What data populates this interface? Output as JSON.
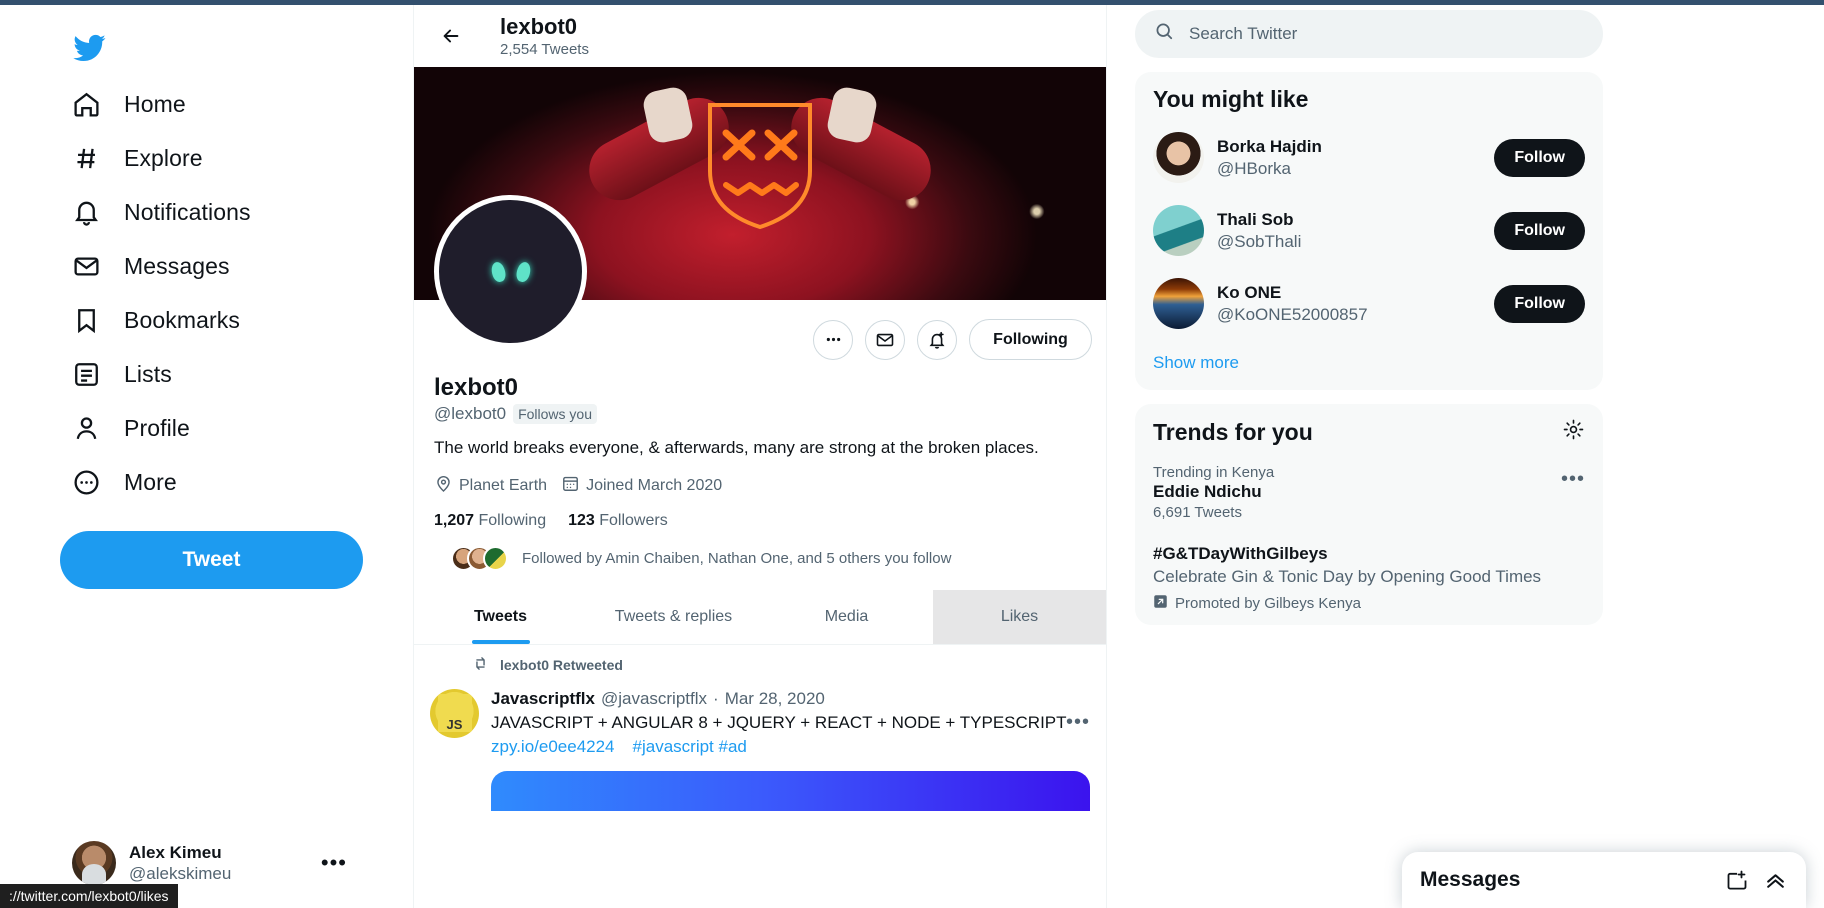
{
  "sidebar": {
    "logo_icon": "twitter-bird-icon",
    "items": [
      {
        "label": "Home",
        "icon": "home-icon"
      },
      {
        "label": "Explore",
        "icon": "hash-icon"
      },
      {
        "label": "Notifications",
        "icon": "bell-icon"
      },
      {
        "label": "Messages",
        "icon": "envelope-icon"
      },
      {
        "label": "Bookmarks",
        "icon": "bookmark-icon"
      },
      {
        "label": "Lists",
        "icon": "list-icon"
      },
      {
        "label": "Profile",
        "icon": "person-icon"
      },
      {
        "label": "More",
        "icon": "more-circle-icon"
      }
    ],
    "tweet_button": "Tweet",
    "account": {
      "name": "Alex Kimeu",
      "handle": "@alekskimeu",
      "menu_icon": "more-dots-icon"
    }
  },
  "header": {
    "back_icon": "back-arrow-icon",
    "title": "lexbot0",
    "tweet_count": "2,554 Tweets"
  },
  "profile": {
    "name": "lexbot0",
    "handle": "@lexbot0",
    "follows_you_badge": "Follows you",
    "bio": "The world breaks everyone, & afterwards, many are strong at the broken places.",
    "location": "Planet Earth",
    "joined": "Joined March 2020",
    "following_count": "1,207",
    "following_label": "Following",
    "followers_count": "123",
    "followers_label": "Followers",
    "followed_by": "Followed by Amin Chaiben, Nathan One, and 5 others you follow",
    "actions": {
      "more_icon": "more-dots-icon",
      "message_icon": "envelope-icon",
      "notify_icon": "bell-plus-icon",
      "follow_state": "Following"
    },
    "tabs": [
      {
        "label": "Tweets",
        "active": true
      },
      {
        "label": "Tweets & replies",
        "active": false
      },
      {
        "label": "Media",
        "active": false
      },
      {
        "label": "Likes",
        "active": false
      }
    ]
  },
  "timeline": {
    "retweet_icon": "retweet-icon",
    "retweet_label": "lexbot0 Retweeted",
    "tweet": {
      "author": "Javascriptflx",
      "handle": "@javascriptflx",
      "separator": "·",
      "date": "Mar 28, 2020",
      "text": "JAVASCRIPT + ANGULAR 8 + JQUERY + REACT + NODE + TYPESCRIPT",
      "link": "zpy.io/e0ee4224",
      "hashtags": [
        "#javascript",
        "#ad"
      ],
      "more_icon": "more-dots-icon"
    }
  },
  "search": {
    "icon": "search-icon",
    "placeholder": "Search Twitter",
    "value": ""
  },
  "you_might_like": {
    "title": "You might like",
    "users": [
      {
        "name": "Borka Hajdin",
        "handle": "@HBorka",
        "button": "Follow"
      },
      {
        "name": "Thali Sob",
        "handle": "@SobThali",
        "button": "Follow"
      },
      {
        "name": "Ko ONE",
        "handle": "@KoONE52000857",
        "button": "Follow"
      }
    ],
    "show_more": "Show more"
  },
  "trends": {
    "title": "Trends for you",
    "settings_icon": "gear-icon",
    "items": [
      {
        "context": "Trending in Kenya",
        "name": "Eddie Ndichu",
        "count": "6,691 Tweets",
        "description": "",
        "promoted": "",
        "more_icon": "more-dots-icon"
      },
      {
        "context": "",
        "name": "#G&TDayWithGilbeys",
        "count": "",
        "description": "Celebrate Gin & Tonic Day by Opening Good Times",
        "promoted": "Promoted by Gilbeys Kenya",
        "more_icon": ""
      }
    ]
  },
  "messages_dock": {
    "title": "Messages",
    "new_message_icon": "new-message-icon",
    "expand_icon": "chevron-up-icon"
  },
  "status_bar": {
    "url": "://twitter.com/lexbot0/likes"
  },
  "colors": {
    "accent": "#1d9bf0",
    "text": "#0f1419",
    "muted": "#536471",
    "panel": "#f7f9f9"
  }
}
